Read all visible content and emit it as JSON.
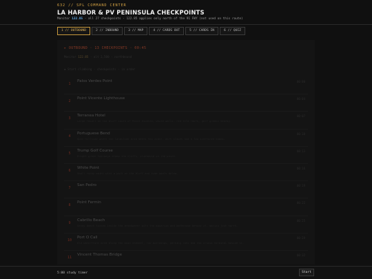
{
  "header": {
    "eyebrow": "632 // SPL COMMAND CENTER",
    "title": "LA HARBOR & PV PENINSULA CHECKPOINTS",
    "subtitle_prefix": "Monitor",
    "subtitle_accent": "122.85",
    "subtitle_rest": "· all 27 checkpoints · 122.85 applies only north of the 91 FWY (not used on this route)"
  },
  "tabs": [
    {
      "label": "1 // OUTBOUND",
      "active": true
    },
    {
      "label": "2 // INBOUND",
      "active": false
    },
    {
      "label": "3 // MAP",
      "active": false
    },
    {
      "label": "4 // CARDS OUT",
      "active": false
    },
    {
      "label": "5 // CARDS IN",
      "active": false
    },
    {
      "label": "6 // QUIZ",
      "active": false
    }
  ],
  "section": {
    "title": "▸ OUTBOUND · 13 CHECKPOINTS · 00:45",
    "meta_prefix": "Monitor",
    "meta_freq": "122.85",
    "meta_rest": "· alt 2,500 · northbound",
    "note": "▪ Start climbing · checkpoints · in order"
  },
  "checkpoints": [
    {
      "num": "1",
      "name": "Palos Verdes Point",
      "desc": "",
      "mile": "00:00"
    },
    {
      "num": "2",
      "name": "Point Vicente Lighthouse",
      "desc": "",
      "mile": "00:04"
    },
    {
      "num": "3",
      "name": "Terranea Hotel",
      "desc": "Large resort on the bluff south of Point Vicente, white walls, red tile roofs, golf greens nearby.",
      "mile": "00:07"
    },
    {
      "num": "4",
      "name": "Portuguese Bend",
      "desc": "Open hillside where the landslide area meets the coast, dirt slopes and a few scattered homes.",
      "mile": "00:10"
    },
    {
      "num": "5",
      "name": "Trump Golf Course",
      "desc": "Bright green fairways along the cliffs, clubhouse on the point.",
      "mile": "00:13"
    },
    {
      "num": "6",
      "name": "White Point",
      "desc": "Small rocky point with a park on the bluff and tide pools below.",
      "mile": "00:16"
    },
    {
      "num": "7",
      "name": "San Pedro",
      "desc": "",
      "mile": "00:19"
    },
    {
      "num": "8",
      "name": "Point Fermin",
      "desc": "",
      "mile": "00:22"
    },
    {
      "num": "9",
      "name": "Cabrillo Beach",
      "desc": "Sandy beach tucked inside the breakwater with the aquarium and bathhouse behind it, marina just north.",
      "mile": "00:25"
    },
    {
      "num": "10",
      "name": "Port O Call",
      "desc": "Old waterfront area along the main channel, low buildings, parking lots and the cruise terminal beside it.",
      "mile": "00:29"
    },
    {
      "num": "11",
      "name": "Vincent Thomas Bridge",
      "desc": "",
      "mile": "00:32"
    }
  ],
  "footer": {
    "timer": "5:00 study timer",
    "start_label": "Start"
  }
}
